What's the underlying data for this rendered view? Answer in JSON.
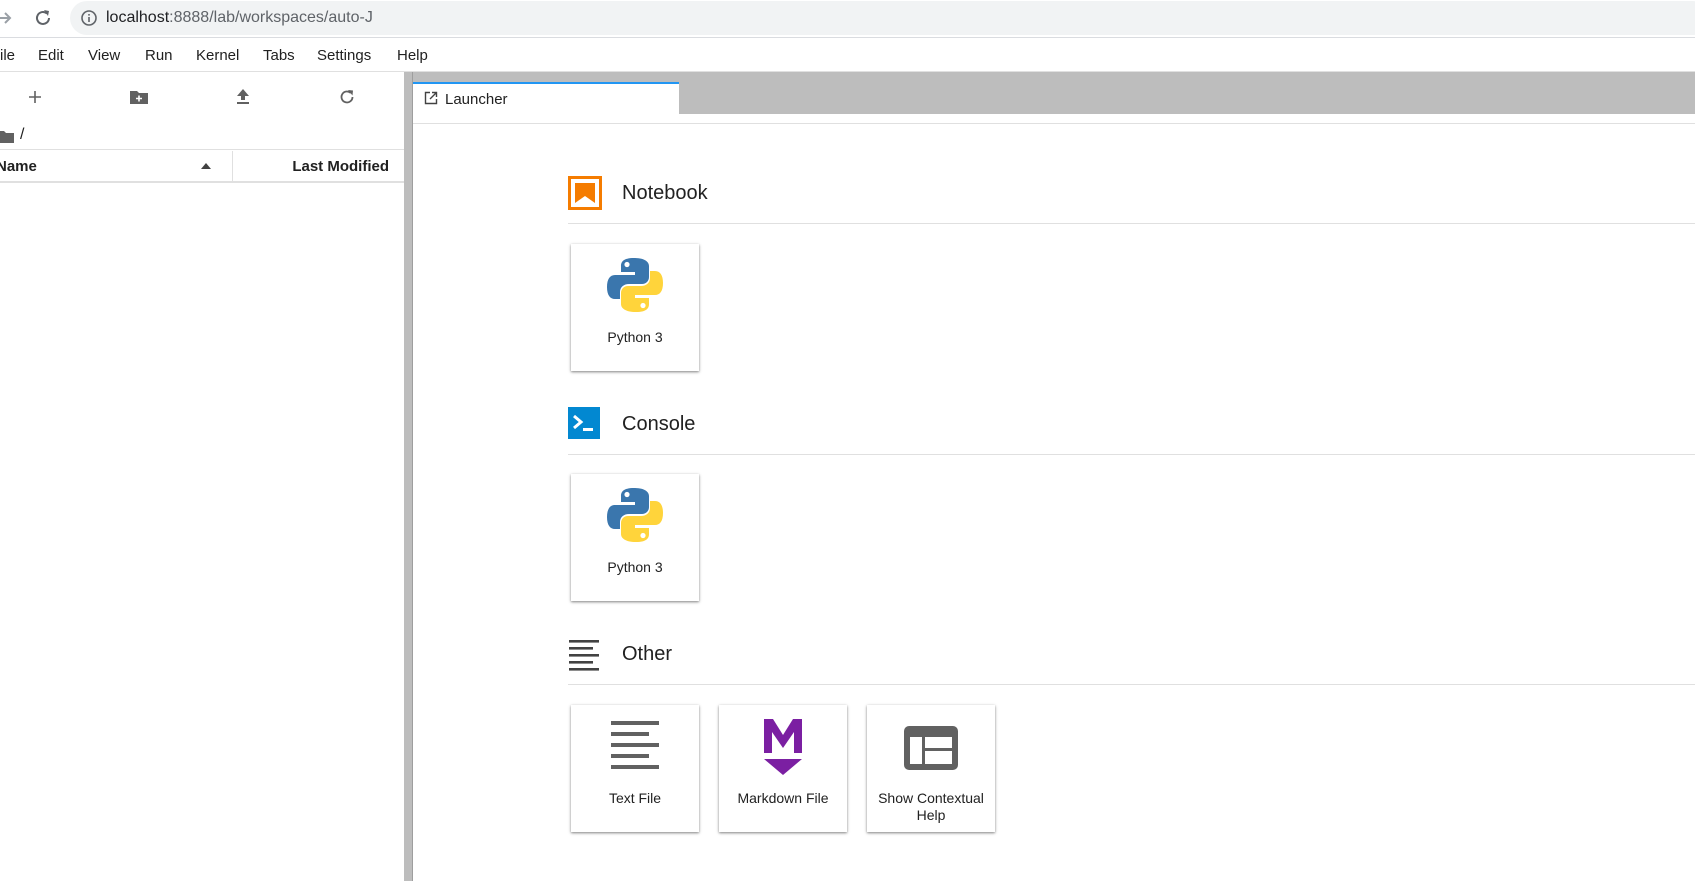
{
  "browser": {
    "url_host": "localhost",
    "url_path": ":8888/lab/workspaces/auto-J"
  },
  "menu": {
    "items": [
      "ile",
      "Edit",
      "View",
      "Run",
      "Kernel",
      "Tabs",
      "Settings",
      "Help"
    ]
  },
  "file_browser": {
    "breadcrumb_root": "/",
    "header_name": "Name",
    "header_modified": "Last Modified"
  },
  "tabs": [
    {
      "label": "Launcher"
    }
  ],
  "launcher": {
    "sections": [
      {
        "title": "Notebook",
        "icon": "notebook-icon",
        "cards": [
          {
            "label": "Python 3",
            "icon": "python-icon"
          }
        ]
      },
      {
        "title": "Console",
        "icon": "console-icon",
        "cards": [
          {
            "label": "Python 3",
            "icon": "python-icon"
          }
        ]
      },
      {
        "title": "Other",
        "icon": "other-icon",
        "cards": [
          {
            "label": "Text File",
            "icon": "text-file-icon"
          },
          {
            "label": "Markdown File",
            "icon": "markdown-icon"
          },
          {
            "label": "Show Contextual Help",
            "icon": "contextual-help-icon"
          }
        ]
      }
    ]
  },
  "colors": {
    "notebook_orange": "#f57c00",
    "console_blue": "#0288d1",
    "markdown_purple": "#7b1fa2",
    "python_blue": "#3a76ad",
    "python_yellow": "#ffd43b",
    "tab_accent": "#2196f3"
  }
}
